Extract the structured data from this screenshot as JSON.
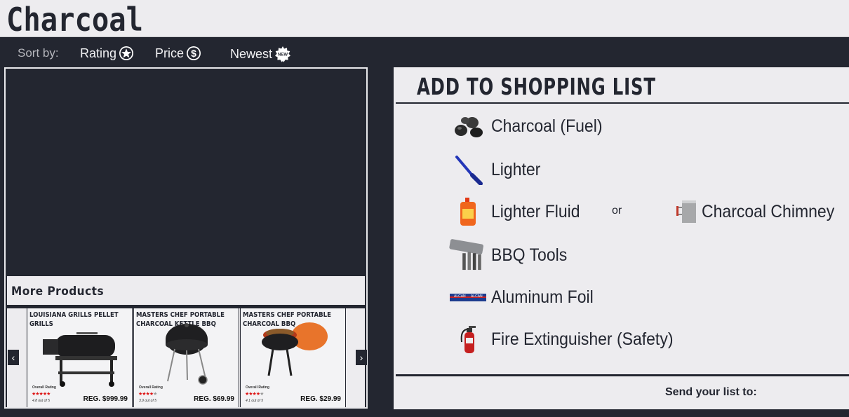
{
  "header": {
    "title": "Charcoal"
  },
  "sort": {
    "label": "Sort by:",
    "options": [
      {
        "label": "Rating",
        "icon": "star-circle-icon"
      },
      {
        "label": "Price",
        "icon": "dollar-circle-icon"
      },
      {
        "label": "Newest",
        "icon": "new-badge-icon"
      }
    ]
  },
  "more_products": {
    "title": "More Products",
    "items": [
      {
        "name": "Louisiana Grills Pellet Grills",
        "rating_label": "Overall Rating",
        "rating_text": "4.8 out of 5",
        "rating": 4.8,
        "price_prefix": "REG.",
        "price": "$999.99"
      },
      {
        "name": "Masters Chef portable charcoal Kettle BBQ",
        "rating_label": "Overall Rating",
        "rating_text": "3.9 out of 5",
        "rating": 3.9,
        "price_prefix": "REG.",
        "price": "$69.99"
      },
      {
        "name": "Masters Chef portable charcoal BBQ",
        "rating_label": "Overall Rating",
        "rating_text": "4.1 out of 5",
        "rating": 4.1,
        "price_prefix": "REG.",
        "price": "$29.99"
      }
    ]
  },
  "shopping_list": {
    "title": "Add to shopping list",
    "items": [
      {
        "label": "Charcoal (Fuel)",
        "icon": "charcoal-briquettes-icon"
      },
      {
        "label": "Lighter",
        "icon": "lighter-icon"
      },
      {
        "label": "Lighter Fluid",
        "icon": "lighter-fluid-icon"
      },
      {
        "label": "BBQ Tools",
        "icon": "bbq-tools-icon"
      },
      {
        "label": "Aluminum Foil",
        "icon": "aluminum-foil-icon"
      },
      {
        "label": "Fire Extinguisher (Safety)",
        "icon": "fire-extinguisher-icon"
      }
    ],
    "alternative_separator": "or",
    "alternative": {
      "label": "Charcoal Chimney",
      "icon": "charcoal-chimney-icon"
    },
    "send_label": "Send your list to:"
  }
}
